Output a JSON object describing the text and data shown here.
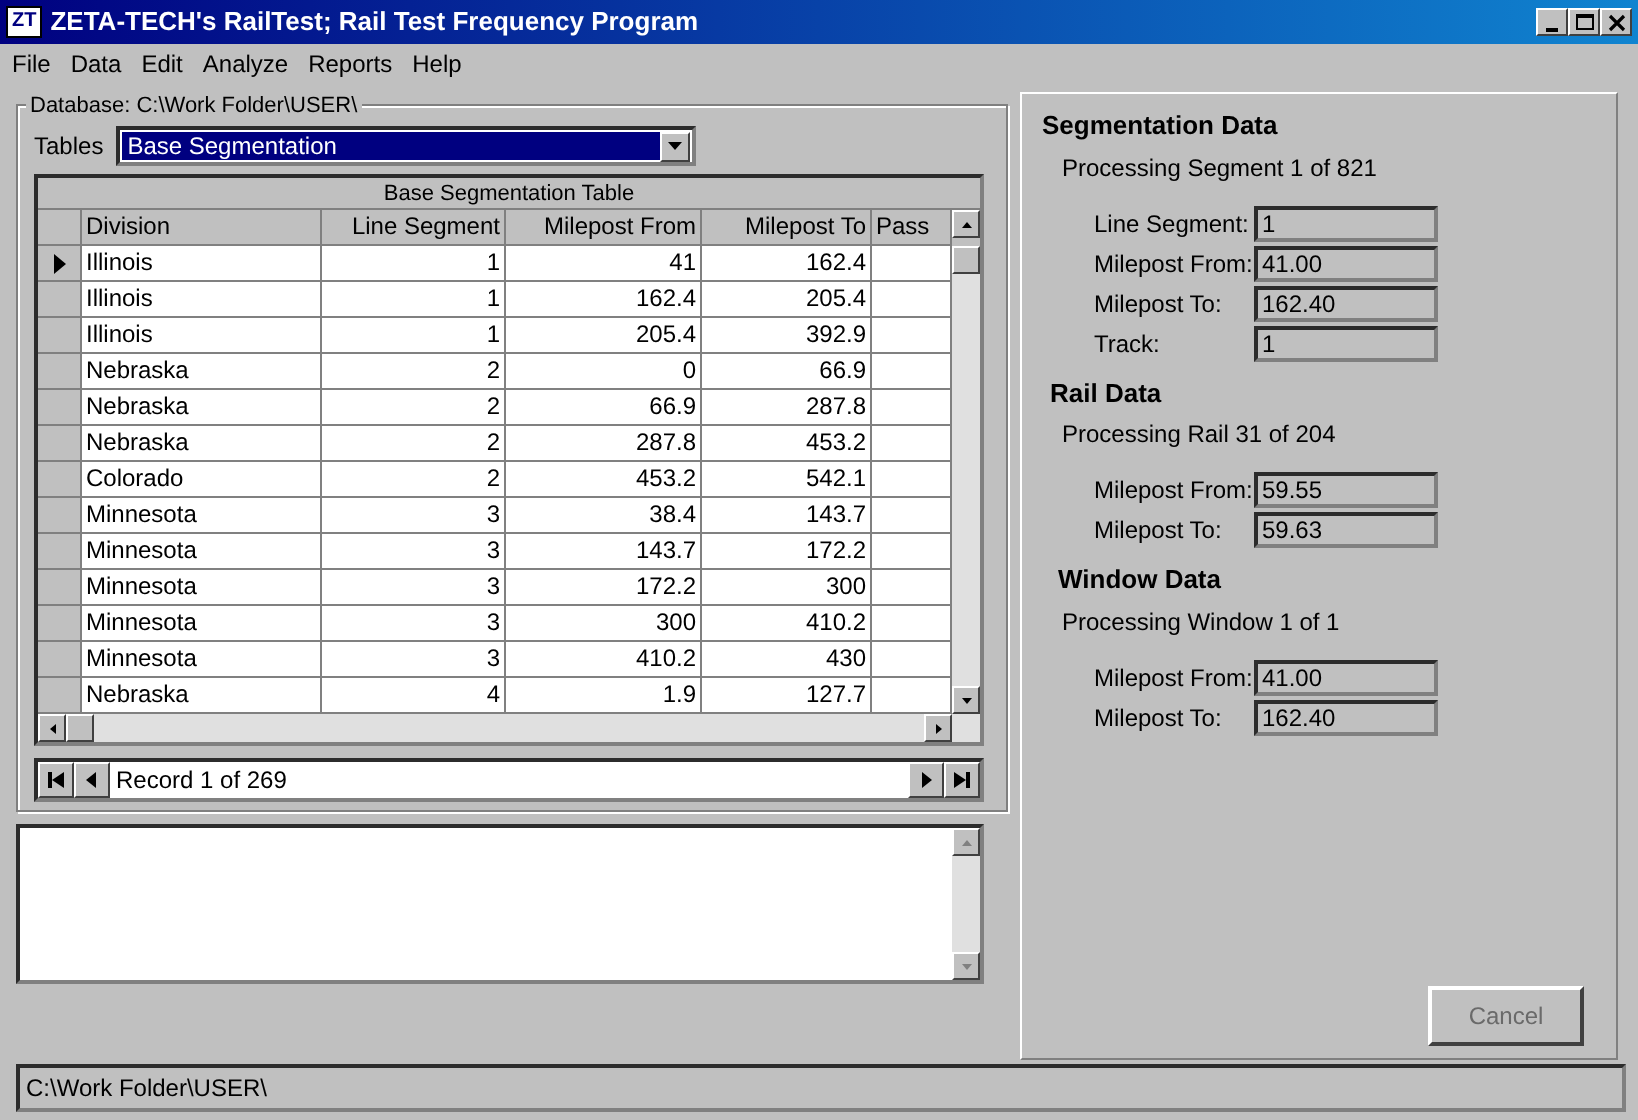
{
  "window": {
    "logo": "ZT",
    "title": "ZETA-TECH's RailTest; Rail Test Frequency Program"
  },
  "menu": [
    "File",
    "Data",
    "Edit",
    "Analyze",
    "Reports",
    "Help"
  ],
  "database": {
    "label": "Database: C:\\Work Folder\\USER\\"
  },
  "tables": {
    "label": "Tables",
    "value": "Base Segmentation"
  },
  "grid": {
    "caption": "Base Segmentation Table",
    "columns": [
      "Division",
      "Line Segment",
      "Milepost From",
      "Milepost To",
      "Pass"
    ],
    "rows": [
      {
        "selected": true,
        "cells": [
          "Illinois",
          "1",
          "41",
          "162.4"
        ]
      },
      {
        "selected": false,
        "cells": [
          "Illinois",
          "1",
          "162.4",
          "205.4"
        ]
      },
      {
        "selected": false,
        "cells": [
          "Illinois",
          "1",
          "205.4",
          "392.9"
        ]
      },
      {
        "selected": false,
        "cells": [
          "Nebraska",
          "2",
          "0",
          "66.9"
        ]
      },
      {
        "selected": false,
        "cells": [
          "Nebraska",
          "2",
          "66.9",
          "287.8"
        ]
      },
      {
        "selected": false,
        "cells": [
          "Nebraska",
          "2",
          "287.8",
          "453.2"
        ]
      },
      {
        "selected": false,
        "cells": [
          "Colorado",
          "2",
          "453.2",
          "542.1"
        ]
      },
      {
        "selected": false,
        "cells": [
          "Minnesota",
          "3",
          "38.4",
          "143.7"
        ]
      },
      {
        "selected": false,
        "cells": [
          "Minnesota",
          "3",
          "143.7",
          "172.2"
        ]
      },
      {
        "selected": false,
        "cells": [
          "Minnesota",
          "3",
          "172.2",
          "300"
        ]
      },
      {
        "selected": false,
        "cells": [
          "Minnesota",
          "3",
          "300",
          "410.2"
        ]
      },
      {
        "selected": false,
        "cells": [
          "Minnesota",
          "3",
          "410.2",
          "430"
        ]
      },
      {
        "selected": false,
        "cells": [
          "Nebraska",
          "4",
          "1.9",
          "127.7"
        ]
      }
    ]
  },
  "navigator": {
    "record": "Record 1 of 269"
  },
  "sections": [
    {
      "title": "Segmentation Data",
      "progress": "Processing Segment 1 of 821",
      "fields": [
        {
          "label": "Line Segment:",
          "value": "1"
        },
        {
          "label": "Milepost From:",
          "value": "41.00"
        },
        {
          "label": "Milepost To:",
          "value": "162.40"
        },
        {
          "label": "Track:",
          "value": "1"
        }
      ]
    },
    {
      "title": "Rail Data",
      "progress": "Processing Rail 31 of 204",
      "fields": [
        {
          "label": "Milepost From:",
          "value": "59.55"
        },
        {
          "label": "Milepost To:",
          "value": "59.63"
        }
      ]
    },
    {
      "title": "Window Data",
      "progress": "Processing Window 1 of 1",
      "fields": [
        {
          "label": "Milepost From:",
          "value": "41.00"
        },
        {
          "label": "Milepost To:",
          "value": "162.40"
        }
      ]
    }
  ],
  "cancel_button": {
    "label": "Cancel",
    "disabled": true
  },
  "status_bar": "C:\\Work Folder\\USER\\"
}
